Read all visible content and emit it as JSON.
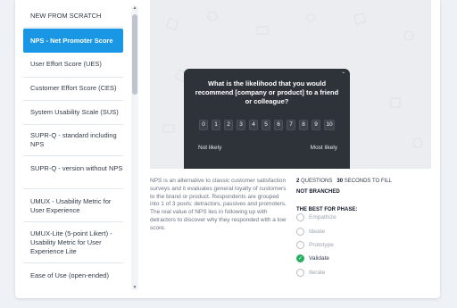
{
  "templates": [
    {
      "label": "NEW FROM SCRATCH",
      "active": false
    },
    {
      "label": "NPS - Net Promoter Score",
      "active": true
    },
    {
      "label": "User Effort Score (UES)",
      "active": false
    },
    {
      "label": "Customer Effort Score (CES)",
      "active": false
    },
    {
      "label": "System Usability Scale (SUS)",
      "active": false
    },
    {
      "label": "SUPR-Q - standard including NPS",
      "active": false
    },
    {
      "label": "SUPR-Q - version without NPS",
      "active": false
    },
    {
      "label": "UMUX - Usability Metric for User Experience",
      "active": false
    },
    {
      "label": "UMUX-Lite (5-point Likert) - Usability Metric for User Experience Lite",
      "active": false
    },
    {
      "label": "Ease of Use (open-ended)",
      "active": false
    }
  ],
  "preview": {
    "question": "What is the likelihood that you would recommend [company or product] to a friend or colleague?",
    "scale": [
      "0",
      "1",
      "2",
      "3",
      "4",
      "5",
      "6",
      "7",
      "8",
      "9",
      "10"
    ],
    "label_low": "Not likely",
    "label_high": "Most likely",
    "close_glyph": "ˇ"
  },
  "description": "NPS is an alternative to classic customer satisfaction surveys and it evaluates general loyalty of customers to the brand or product. Respondents are grouped into 1 of 3 pools: detractors, passives and promoters. The real value of NPS lies in following up with detractors to discover why they responded with a low score.",
  "meta": {
    "questions_count": "2",
    "questions_label": "QUESTIONS",
    "seconds_count": "30",
    "seconds_label": "SECONDS TO FILL",
    "branching": "NOT BRANCHED",
    "phase_title": "THE BEST FOR PHASE:",
    "phases": [
      {
        "label": "Empathize",
        "checked": false
      },
      {
        "label": "Ideate",
        "checked": false
      },
      {
        "label": "Prototype",
        "checked": false
      },
      {
        "label": "Validate",
        "checked": true
      },
      {
        "label": "Iterate",
        "checked": false
      }
    ]
  },
  "colors": {
    "accent": "#1a97e4",
    "widget_bg": "#2e3239",
    "check": "#27ae60"
  }
}
